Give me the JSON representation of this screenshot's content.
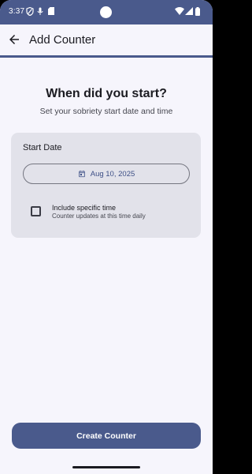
{
  "status_bar": {
    "time": "3:37",
    "icons": [
      "vpn-shield-icon",
      "location-icon",
      "sim-card-icon",
      "wifi-icon",
      "signal-icon",
      "battery-icon"
    ]
  },
  "app_bar": {
    "title": "Add Counter",
    "back_icon": "arrow-back-icon"
  },
  "main": {
    "heading": "When did you start?",
    "subheading": "Set your sobriety start date and time"
  },
  "card": {
    "title": "Start Date",
    "date_value": "Aug 10, 2025",
    "date_icon": "calendar-icon",
    "include_time": {
      "label": "Include specific time",
      "description": "Counter updates at this time daily",
      "checked": false
    }
  },
  "footer": {
    "create_label": "Create Counter"
  },
  "colors": {
    "primary": "#4a5a8c",
    "background": "#f6f5fc",
    "card": "#e2e2ea",
    "accent_text": "#3d4f86"
  }
}
